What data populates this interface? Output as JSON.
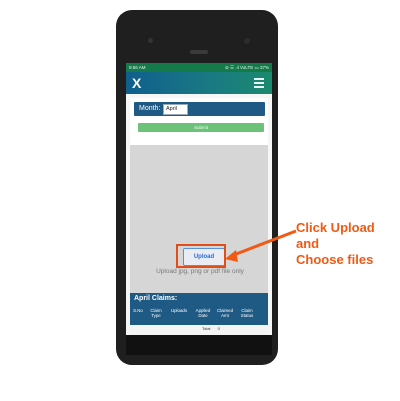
{
  "status_bar": {
    "time": "9:56 AM",
    "icons_text": "⊘ ☰ .ıl VoLTE ▭ 37%"
  },
  "app_bar": {
    "logo_text": "X",
    "menu_icon": "hamburger-menu-icon"
  },
  "month_selector": {
    "label": "Month:",
    "value": "April"
  },
  "submit_label": "Submit",
  "upload": {
    "button_label": "Upload",
    "hint": "Upload jpg, png or pdf file only"
  },
  "claims": {
    "title": "April Claims:",
    "columns": [
      "S.No",
      "Claim Type",
      "Uploads",
      "Applied Date",
      "Claimed Amt",
      "Claim Status"
    ],
    "total_label": "Total",
    "total_value": "0"
  },
  "callout": {
    "line1": "Click Upload",
    "line2": "and",
    "line3": "Choose files"
  },
  "colors": {
    "appbar_start": "#0f5f8d",
    "appbar_end": "#1b8a6e",
    "header_blue": "#1e5a84",
    "submit_green": "#6dc27a",
    "callout_orange": "#f05a14"
  }
}
